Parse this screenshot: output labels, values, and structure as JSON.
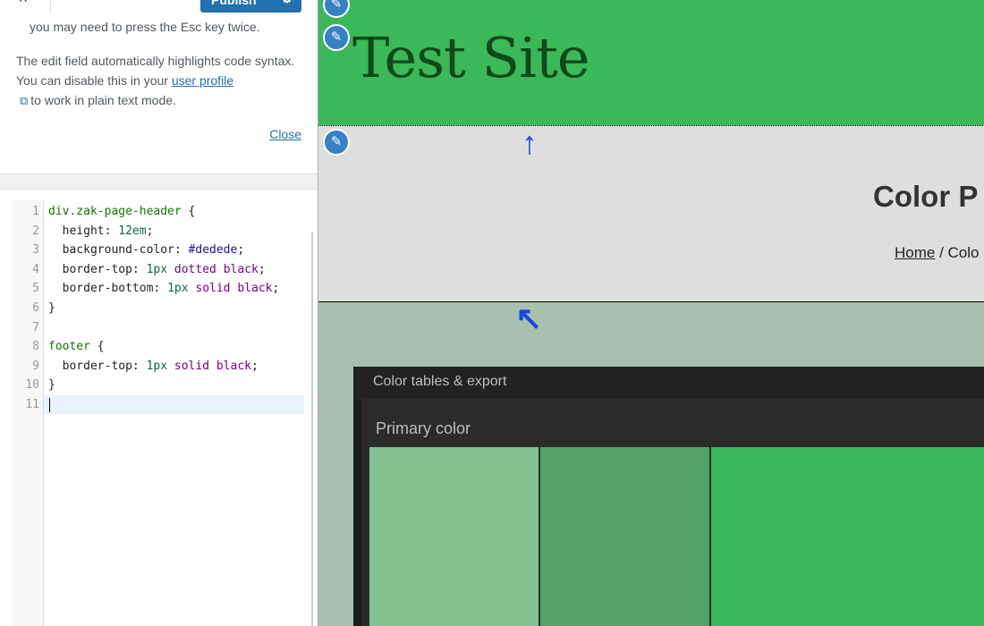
{
  "customizer": {
    "publish_label": "Publish",
    "help_text_1": "you may need to press the Esc key twice.",
    "help_text_2_pre": "The edit field automatically highlights code syntax. You can disable this in your ",
    "help_link": "user profile",
    "help_text_2_post": "to work in plain text mode.",
    "close_label": "Close"
  },
  "code_editor": {
    "line_numbers": [
      "1",
      "2",
      "3",
      "4",
      "5",
      "6",
      "7",
      "8",
      "9",
      "10",
      "11"
    ],
    "lines": [
      "div.zak-page-header {",
      "  height: 12em;",
      "  background-color: #dedede;",
      "  border-top: 1px dotted black;",
      "  border-bottom: 1px solid black;",
      "}",
      "",
      "footer {",
      "  border-top: 1px solid black;",
      "}",
      ""
    ]
  },
  "preview": {
    "site_title": "Test Site",
    "page_title": "Color P",
    "breadcrumb_home": "Home",
    "breadcrumb_sep": " / ",
    "breadcrumb_current": "Colo",
    "panel_title": "Color tables & export",
    "panel_label": "Primary color",
    "swatches": [
      "#82c291",
      "#52a465",
      "#3bb85a"
    ],
    "colors": {
      "header_bg": "#3bb85a",
      "page_header_bg": "#dedede",
      "body_bg": "#a8c1ae",
      "annotation_arrow": "#1a47e0"
    }
  }
}
